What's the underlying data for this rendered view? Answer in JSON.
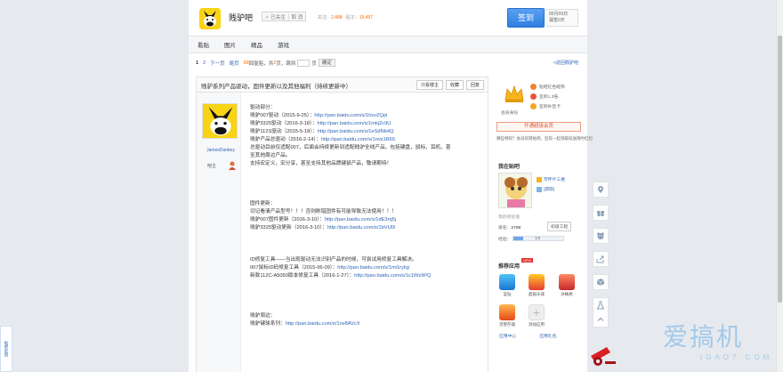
{
  "header": {
    "forum_name": "贱驴吧",
    "follow_status": "✓ 已关注",
    "unfollow": "取 消",
    "follow_label": "关注：",
    "follow_count": "2,488",
    "posts_label": "贴子：",
    "posts_count": "19,457",
    "signin_label": "签到",
    "sign_date": "06月09日",
    "sign_days": "漏签0天"
  },
  "nav": {
    "tabs": [
      "看贴",
      "图片",
      "精品",
      "游戏"
    ]
  },
  "pager": {
    "current": "1",
    "page2": "2",
    "next": "下一页",
    "last": "尾页",
    "reply_count": "68",
    "reply_label": "回复贴，共",
    "total_pages": "2",
    "total_label": "页，跳到",
    "page_unit": "页",
    "go": "确定",
    "back_link": "<返回贱驴吧"
  },
  "thread": {
    "title": "贱驴系列产品驱动，固件更新以及其他福利（持续更新中）",
    "buttons": [
      "只看楼主",
      "收藏",
      "回复"
    ],
    "author": {
      "name": "JamesDonkey",
      "rank": "吧主"
    },
    "lines": [
      {
        "text": "驱动部分："
      },
      {
        "text": "贱驴007驱动（2015-9-25）：",
        "link": "http://pan.baidu.com/s/1hsvZQpi"
      },
      {
        "text": "贱驴3325驱动（2016-3-18）：",
        "link": "http://pan.baidu.com/s/1mkj2c9U"
      },
      {
        "text": "贱驴112S驱动（2015-5-18）：",
        "link": "http://pan.baidu.com/s/1eSdNb4Q"
      },
      {
        "text": "贱驴产品总驱动（2016-2-14）：",
        "link": "http://pan.baidu.com/s/1nvs1R65"
      },
      {
        "text": "总驱动目前仅适配007，后面会持续更新到适配贱驴全线产品，包括键盘，鼠标，耳机，甚"
      },
      {
        "text": "至其他周边产品。"
      },
      {
        "text": "支持宏定义，宏分享，甚至支持其他品牌键鼠产品，敬请期待！"
      },
      {
        "text": ""
      },
      {
        "text": ""
      },
      {
        "text": ""
      },
      {
        "text": ""
      },
      {
        "text": "固件更新："
      },
      {
        "text": "切记看清产品型号！！！否则刷错固件有可能导致无法使用！！！"
      },
      {
        "text": "贱驴007固件更新（2016-3-10）：",
        "link": "http://pan.baidu.com/s/1dE3rq5j"
      },
      {
        "text": "贱驴3325驱动更新（2016-3-10）：",
        "link": "http://pan.baidu.com/s/1bVtJ0i"
      },
      {
        "text": ""
      },
      {
        "text": ""
      },
      {
        "text": ""
      },
      {
        "text": "ID修复工具——当出现驱动无法识别产品的时候，可尝试用修复工具解决。"
      },
      {
        "text": "007鼠标ID码修复工具（2015-06-09）：",
        "link": "http://pan.baidu.com/s/1mi1rykg"
      },
      {
        "text": "新款112C-A5050版本修复工具（2016-1-27）：",
        "link": "http://pan.baidu.com/s/1c1Wz9PQ"
      },
      {
        "text": ""
      },
      {
        "text": ""
      },
      {
        "text": ""
      },
      {
        "text": ""
      },
      {
        "text": "贱驴周边："
      },
      {
        "text": "贱驴键球系列：",
        "link": "http://pan.baidu.com/s/1nv8AVcX"
      }
    ]
  },
  "sidebar": {
    "member_label": "会员身份",
    "perks": [
      "贴吧红色昵称",
      "签到1.3倍",
      "签到补签卡"
    ],
    "open_vip": "开通超级会员",
    "promo": "哪些特权？会员玩转贴吧，狂欢一起领取就送限时红包",
    "my_forum_title": "我在贴吧",
    "my_name": "奈怀什三君",
    "my_exp_btn": "[获取]",
    "exp_label": "我的经验值",
    "rank_label": "排名：",
    "rank_value": "2708",
    "level_label": "初级工程",
    "exp_label2": "经验：",
    "exp_value": "1/5",
    "exp_fill": 0.2,
    "apps_title": "推荐应用",
    "new_badge": "NEW",
    "apps": [
      "蓝钻",
      "超级乐城",
      "冰桶君",
      "贪婪存器",
      "添加应用"
    ],
    "app_center": "应用中心",
    "app_gift": "应用礼包"
  },
  "float_icons": [
    "location-icon",
    "gift-icon",
    "pet-icon",
    "share-icon",
    "cube-icon",
    "lab-icon",
    "back-to-top-icon"
  ],
  "feedback": "贴吧反馈",
  "watermark": {
    "cn": "爱搞机",
    "en": "IGAO7.COM"
  },
  "colors": {
    "accent": "#2d64b3",
    "signin": "#3a88e8",
    "highlight": "#f66a00",
    "page_bg": "#e6eaef"
  }
}
